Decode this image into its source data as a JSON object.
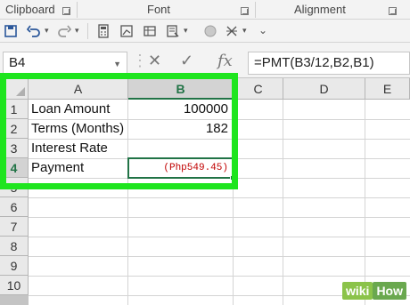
{
  "ribbon": {
    "groups": [
      "Clipboard",
      "Font",
      "Alignment"
    ]
  },
  "qat": {
    "icons": [
      "save-icon",
      "undo-icon",
      "redo-icon",
      "calculator-icon",
      "chart-icon",
      "print-preview-icon",
      "format-painter-icon",
      "circle-icon",
      "sort-icon"
    ]
  },
  "formula_bar": {
    "name_box": "B4",
    "cancel_glyph": "✕",
    "enter_glyph": "✓",
    "fx_glyph": "fx",
    "formula": "=PMT(B3/12,B2,B1)"
  },
  "sheet": {
    "columns": [
      "A",
      "B",
      "C",
      "D",
      "E"
    ],
    "rows": [
      "1",
      "2",
      "3",
      "4",
      "5",
      "6",
      "7",
      "8",
      "9",
      "10"
    ],
    "cells": {
      "A1": "Loan Amount",
      "B1": "100000",
      "A2": "Terms (Months)",
      "B2": "182",
      "A3": "Interest Rate",
      "B3": "",
      "A4": "Payment",
      "B4": "(Php549.45)"
    },
    "active_cell": "B4",
    "highlight_color": "#1ee51e",
    "accent_color": "#217346",
    "negative_color": "#c00000"
  },
  "watermark": {
    "wiki": "wiki",
    "how": "How"
  }
}
